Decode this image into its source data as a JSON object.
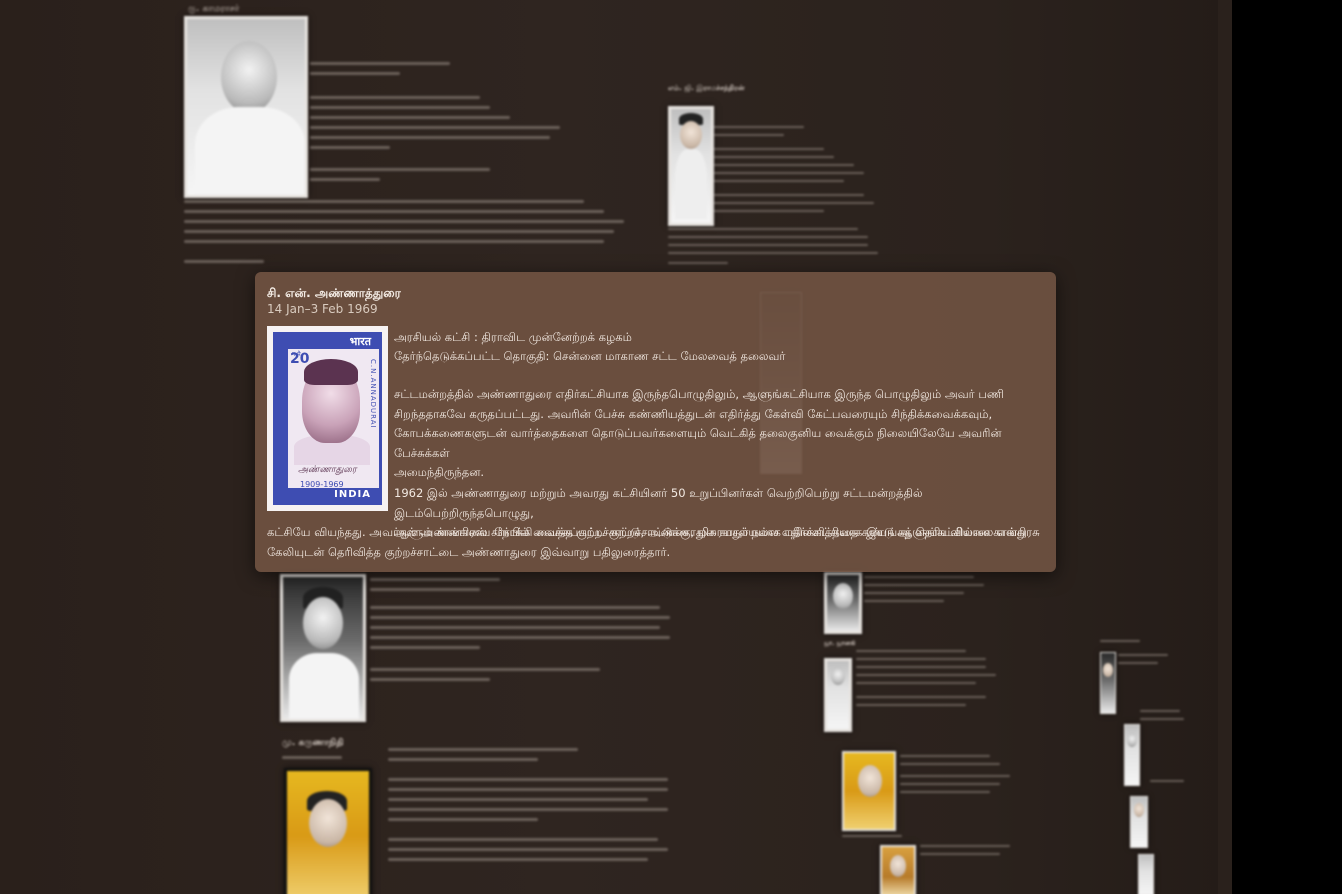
{
  "card": {
    "title": "சி. என். அண்ணாத்துரை",
    "date": "14 Jan–3 Feb 1969",
    "party": "அரசியல் கட்சி : திராவிட முன்னேற்றக் கழகம்",
    "constituency": "தேர்ந்தெடுக்கப்பட்ட தொகுதி: சென்னை மாகாண சட்ட மேலவைத் தலைவர்",
    "paragraph1": [
      "சட்டமன்றத்தில் அண்ணாதுரை எதிர்கட்சியாக இருந்தபொழுதிலும், ஆளுங்கட்சியாக இருந்த பொழுதிலும் அவர் பணி",
      "சிறந்ததாகவே கருதப்பட்டது. அவரின் பேச்சு கண்ணியத்துடன் எதிர்த்து கேள்வி கேட்பவரையும் சிந்திக்கவைக்கவும்,",
      "கோபக்கணைகளுடன் வார்த்தைகளை தொடுப்பவர்களையும் வெட்கித் தலைகுனிய வைக்கும் நிலையிலேயே அவரின் பேச்சுக்கள்",
      "அமைந்திருந்தன."
    ],
    "paragraph2_indented": [
      "1962 இல் அண்ணாதுரை மற்றும் அவரது கட்சியினர் 50 உறுப்பினர்கள் வெற்றிபெற்று சட்டமன்றத்தில் இடம்பெற்றிருந்தபொழுது,",
      "ஆளும் காங்கிரஸ் சார்பில் வைக்கப்பட்ட குற்றச்சாட்டுக்கு, மிக சாதுர்யமாக பதிலளித்ததை கண்டு ஆளுங்கட்சியான காங்கிரசு"
    ],
    "paragraph2_full": [
      "கட்சியே வியந்தது. அவர்கள் அண்ணாவை நோக்கி வைத்த குற்றச்சாட்டு, அண்ணாதுரையால் நல்ல எதிர்க்கட்சியாக இயங்கத் தெரியவில்லை என்று",
      "கேலியுடன் தெரிவித்த குற்றச்சாட்டை அண்ணாதுரை இவ்வாறு பதிலுரைத்தார்."
    ],
    "stamp": {
      "script": "भारत",
      "value": "20",
      "np": "न.पै.",
      "side_text": "C.N.ANNADURAI",
      "signature": "அண்ணாதுரை",
      "years": "1909-1969",
      "country": "INDIA"
    }
  },
  "background_panels": [
    {
      "title": "கு. காமராசர்",
      "date": "13 Apr 1954–2 Oct 1963"
    },
    {
      "title": "எம். ஜி. இராமச்சந்திரன்",
      "date": "30 Jun 1977–17 Feb 1980"
    },
    {
      "title": "பக்தவத்சலம்",
      "date": "2 Oct 1963–6 Mar 1967"
    },
    {
      "title": "மு. கருணாநிதி",
      "date": "10 Feb 1969–5 Jan 1971"
    },
    {
      "title": "ஜா. ஜானகி",
      "date": "7 Jan 1988–30 Jan 1988"
    },
    {
      "title": "ஜெ. ஜெயலலிதா",
      "date": "24 Jun 1991–12 May 1996"
    }
  ]
}
